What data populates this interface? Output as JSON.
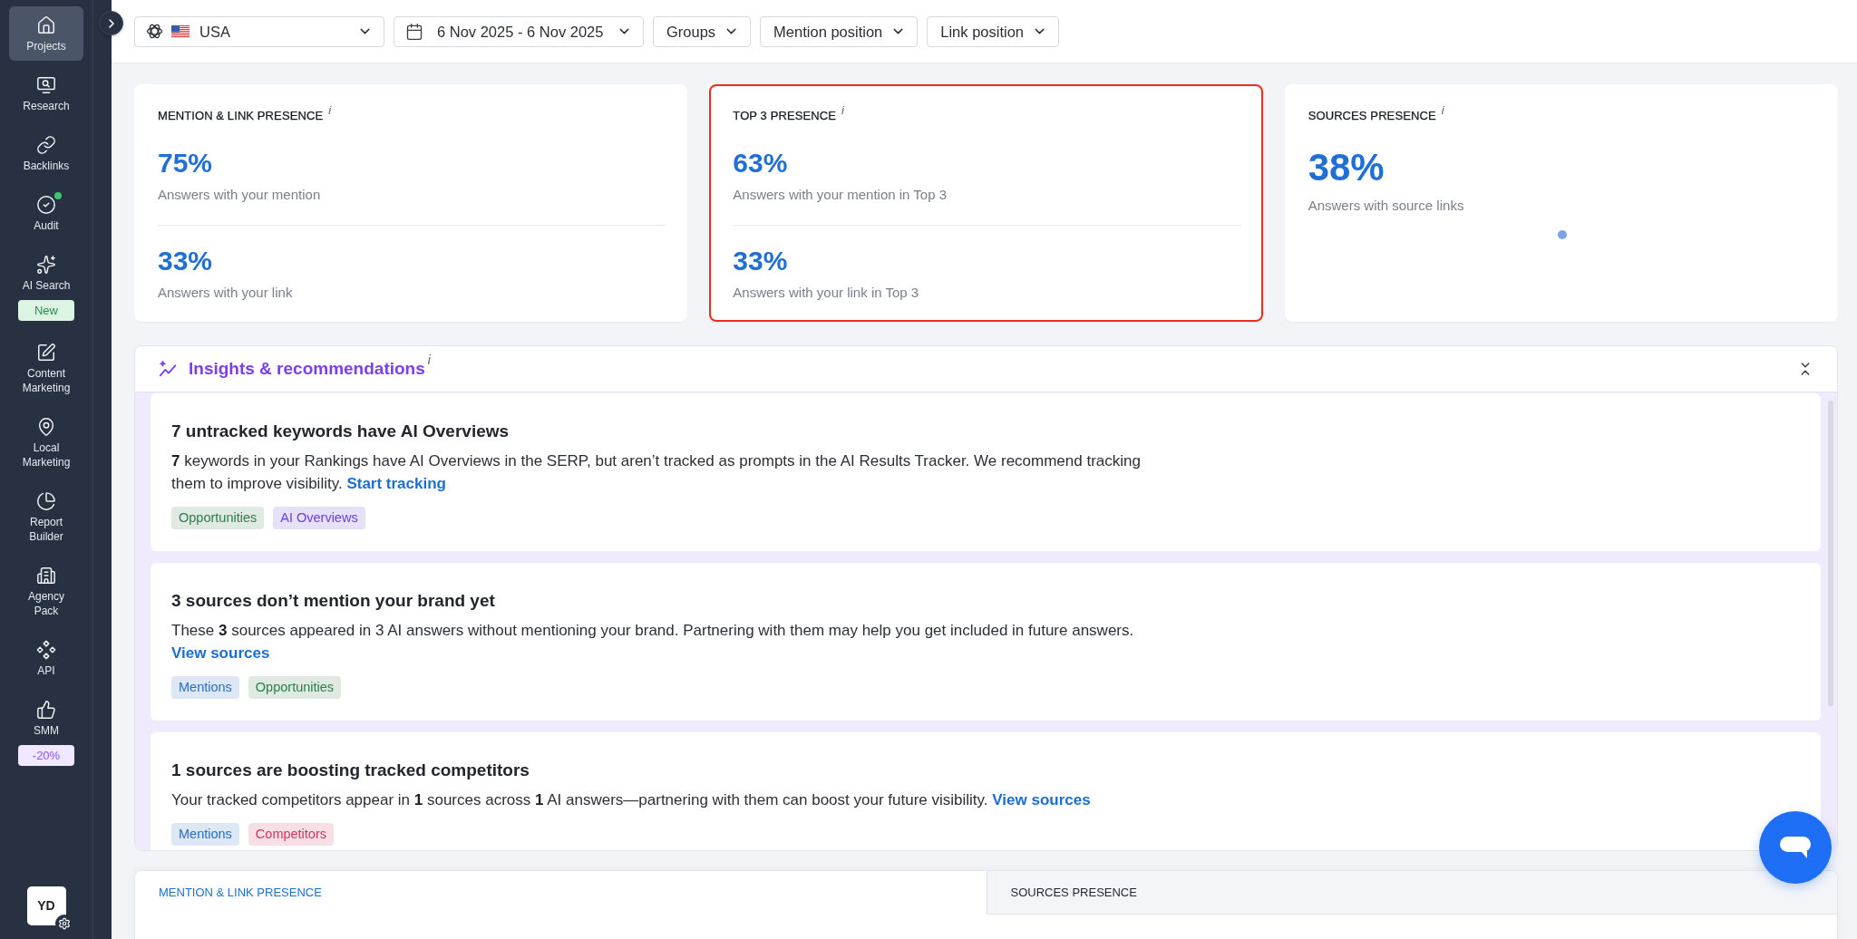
{
  "sidebar": {
    "items": [
      {
        "label": "Projects",
        "selected": true,
        "notification": false
      },
      {
        "label": "Research",
        "selected": false,
        "notification": false
      },
      {
        "label": "Backlinks",
        "selected": false,
        "notification": false
      },
      {
        "label": "Audit",
        "selected": false,
        "notification": true
      },
      {
        "label": "AI Search",
        "selected": false,
        "notification": false,
        "badge": {
          "text": "New",
          "kind": "new"
        }
      },
      {
        "label": "Content Marketing",
        "selected": false,
        "notification": false
      },
      {
        "label": "Local Marketing",
        "selected": false,
        "notification": false
      },
      {
        "label": "Report Builder",
        "selected": false,
        "notification": false
      },
      {
        "label": "Agency Pack",
        "selected": false,
        "notification": false
      },
      {
        "label": "API",
        "selected": false,
        "notification": false
      },
      {
        "label": "SMM",
        "selected": false,
        "notification": false,
        "badge": {
          "text": "-20%",
          "kind": "discount"
        }
      }
    ],
    "avatar": {
      "initials": "YD"
    }
  },
  "toolbar": {
    "filters": [
      {
        "kind": "model",
        "label": "USA"
      },
      {
        "kind": "date",
        "label": "6 Nov 2025 - 6 Nov 2025"
      },
      {
        "kind": "plain",
        "label": "Groups"
      },
      {
        "kind": "plain",
        "label": "Mention position"
      },
      {
        "kind": "plain",
        "label": "Link position"
      }
    ]
  },
  "summary_cards": [
    {
      "kind": "pair",
      "title": "MENTION & LINK PRESENCE",
      "info": "i",
      "highlighted": false,
      "metrics": [
        {
          "value": "75%",
          "label": "Answers with your mention"
        },
        {
          "value": "33%",
          "label": "Answers with your link"
        }
      ]
    },
    {
      "kind": "pair",
      "title": "TOP 3 PRESENCE",
      "info": "i",
      "highlighted": true,
      "metrics": [
        {
          "value": "63%",
          "label": "Answers with your mention in Top 3"
        },
        {
          "value": "33%",
          "label": "Answers with your link in Top 3"
        }
      ]
    },
    {
      "kind": "chart",
      "title": "SOURCES PRESENCE",
      "info": "i",
      "highlighted": false,
      "metrics": [
        {
          "value": "38%",
          "label": "Answers with source links"
        }
      ]
    }
  ],
  "insights": {
    "title": "Insights & recommendations",
    "info": "i",
    "expanded": true,
    "items": [
      {
        "title": "7 untracked keywords have AI Overviews",
        "text": "**7** keywords in your Rankings have AI Overviews in the SERP, but aren’t tracked as prompts in the AI Results Tracker. We recommend tracking them to improve visibility.",
        "link": "Start tracking",
        "tags": [
          {
            "label": "Opportunities",
            "color": "#2e7b4c"
          },
          {
            "label": "AI Overviews",
            "color": "#6a3ddc"
          }
        ]
      },
      {
        "title": "3 sources don’t mention your brand yet",
        "text": "These **3** sources appeared in 3 AI answers without mentioning your brand. Partnering with them may help you get included in future answers.",
        "link": "View sources",
        "tags": [
          {
            "label": "Mentions",
            "color": "#2a6cc0"
          },
          {
            "label": "Opportunities",
            "color": "#2e7b4c"
          }
        ]
      },
      {
        "title": "1 sources are boosting tracked competitors",
        "text": "Your tracked competitors appear in **1** sources across **1** AI answers—partnering with them can boost your future visibility.",
        "link": "View sources",
        "tags": [
          {
            "label": "Mentions",
            "color": "#2a6cc0"
          },
          {
            "label": "Competitors",
            "color": "#d0365a"
          }
        ]
      }
    ]
  },
  "bottom_tabs": [
    {
      "label": "MENTION & LINK PRESENCE",
      "selected": true
    },
    {
      "label": "SOURCES PRESENCE",
      "selected": false
    }
  ]
}
